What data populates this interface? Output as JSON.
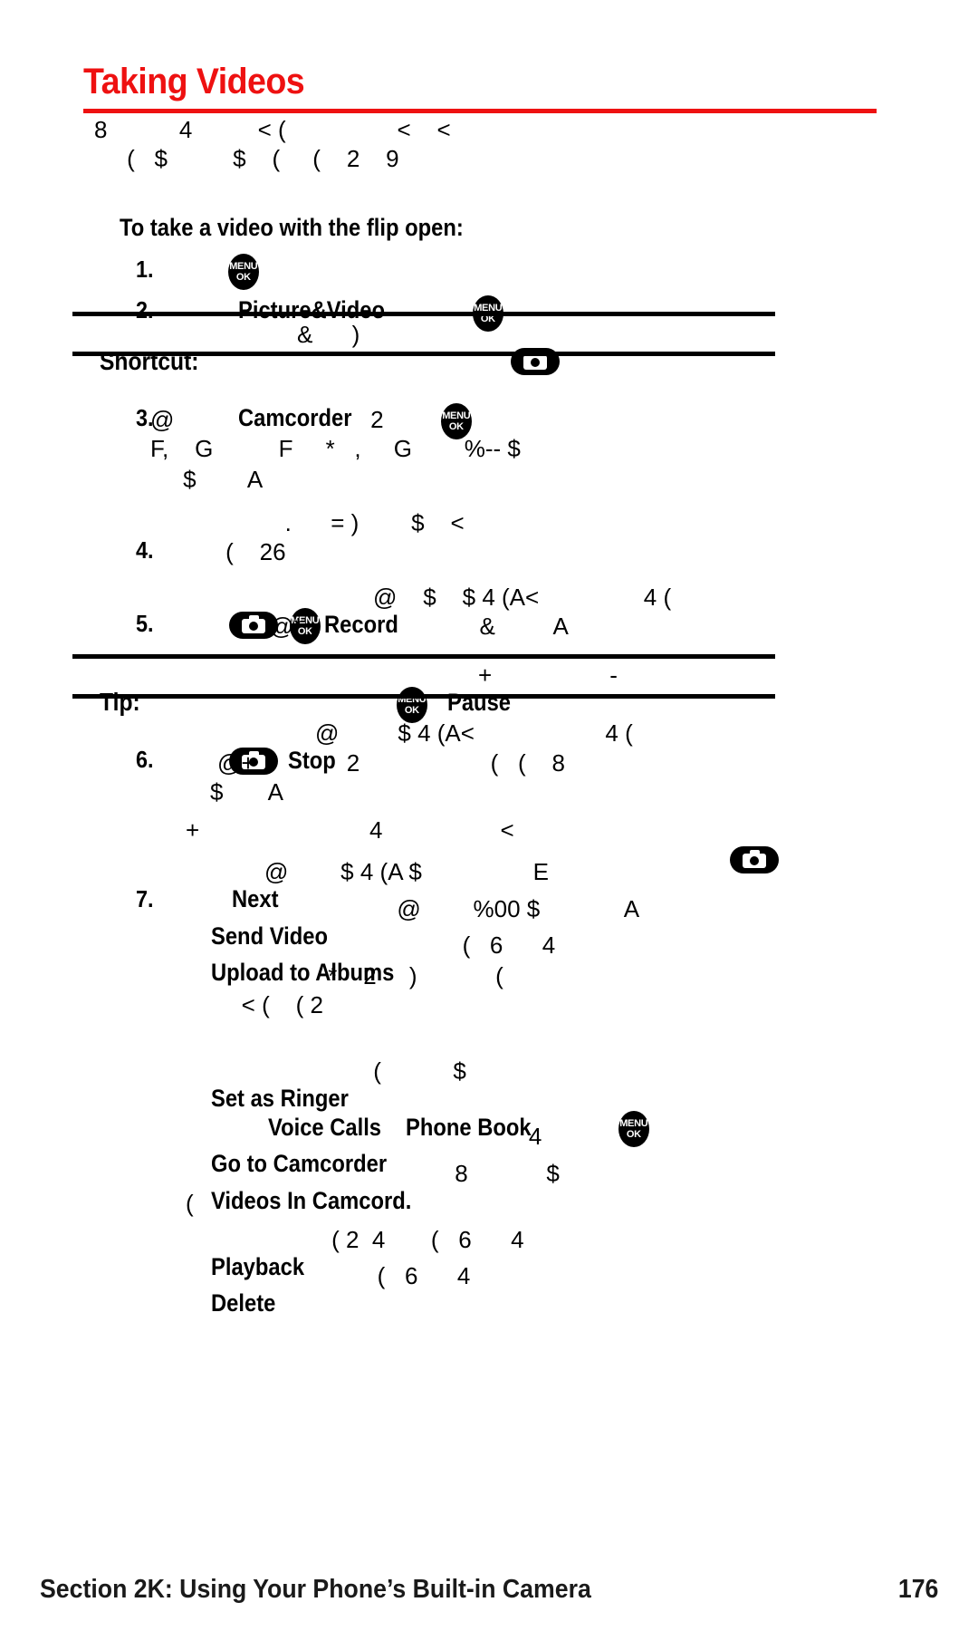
{
  "document": {
    "title": "Taking Videos",
    "title_color": "#ee1111",
    "footer_section": "Section 2K: Using Your Phone’s Built-in Camera",
    "footer_page": "176"
  },
  "intro": {
    "line1": "8           4          < (                 <    <",
    "line2": "     (   $          $    (     (    2    9"
  },
  "lead_in": "To take a video with the flip open:",
  "steps": [
    {
      "number": "1.",
      "icon": "menu-ok-icon",
      "text": ""
    },
    {
      "number": "2.",
      "label": "Picture&Video",
      "icon": "menu-ok-icon",
      "text": ""
    },
    {
      "number": "3.",
      "label": "Camcorder",
      "icon": "menu-ok-icon",
      "lines": [
        "@                              2",
        "F,    G          F     *   ,     G        %-- $",
        "     $        A"
      ]
    },
    {
      "number": "4.",
      "lines": [
        "            .      = )        $    <",
        "     (    26"
      ]
    },
    {
      "number": "5.",
      "icons": [
        "camera-icon",
        "menu-ok-icon"
      ],
      "label": "Record",
      "line1_after": "@    $    $ 4 (A<                4 (",
      "line2": "@* ;                         &         A"
    },
    {
      "number": "6.",
      "icons": [
        "camera-icon"
      ],
      "label": "Stop",
      "line1_after": "@         $ 4 (A<                    4 (",
      "line2": "@+              2                    (   (    8",
      "line3": "$       A"
    },
    {
      "number": "7.",
      "label": "Next",
      "line1_after": "@        $ 4 (A $                 E"
    }
  ],
  "shortcut_bar": {
    "label": "Shortcut:",
    "glyphs": "&      )",
    "icon": "camera-icon"
  },
  "tip_bar": {
    "label": "Tip:",
    "icon": "menu-ok-icon",
    "label2": "Pause",
    "glyphs_after": "+                  -"
  },
  "orphan_line": "+                          4                  <",
  "orphan_icon": "camera-icon",
  "menu_options": [
    {
      "label": "Send Video",
      "glyphs": "               @        %00 $             A"
    },
    {
      "label": "Upload to Albums",
      "glyphs": "                (   6      4"
    },
    {
      "label": "",
      "glyphs": "          *    2     )            ("
    },
    {
      "label": "",
      "glyphs": "   < (    ( 2"
    },
    {
      "label": "Set as Ringer",
      "glyphs": "          (           $"
    },
    {
      "label": "Voice Calls",
      "label_b": "Phone Book",
      "icon": "menu-ok-icon",
      "glyphs": ""
    },
    {
      "label": "Go to Camcorder",
      "glyphs": "                      4"
    },
    {
      "label": "Videos In Camcord.",
      "glyphs": "          8            $"
    },
    {
      "label": "",
      "glyphs": "("
    },
    {
      "label": "Playback",
      "glyphs": "     ( 2  4       (   6      4"
    },
    {
      "label": "Delete",
      "glyphs": "            (   6      4"
    }
  ]
}
